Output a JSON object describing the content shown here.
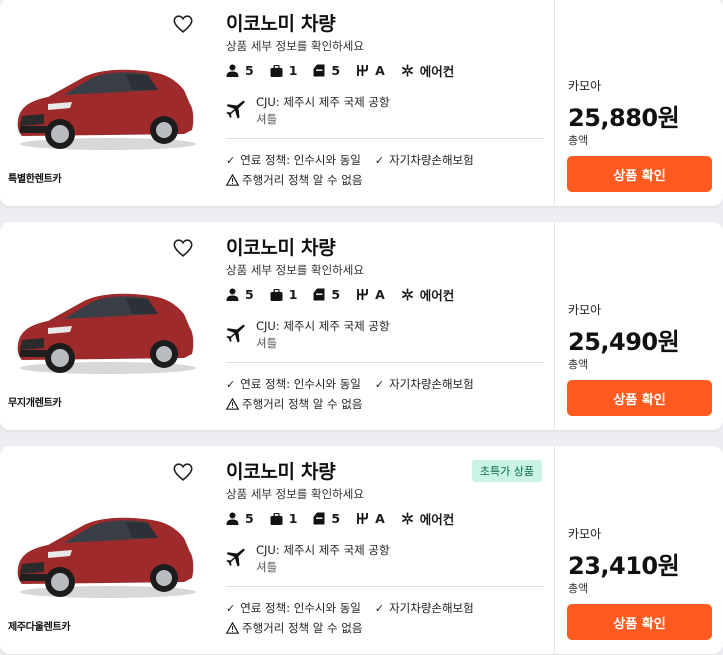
{
  "colors": {
    "accent": "#ff5a1f",
    "badge_bg": "#c9f4e4",
    "badge_fg": "#0b6b4c",
    "car_body": "#9e2a2b"
  },
  "cards": [
    {
      "title": "이코노미 차량",
      "subtitle": "상품 세부 정보를 확인하세요",
      "badge": "",
      "supplier": "특별한렌트카",
      "specs": {
        "seats": "5",
        "bags": "1",
        "doors": "5",
        "transmission": "A",
        "ac": "에어컨"
      },
      "pickup": {
        "location": "CJU: 제주시 제주 국제 공항",
        "type": "셔틀"
      },
      "policies": {
        "fuel": "연료 정책: 인수시와 동일",
        "insurance": "자기차량손해보험",
        "mileage": "주행거리 정책 알 수 없음"
      },
      "vendor": "카모아",
      "price": "25,880원",
      "price_label": "총액",
      "cta": "상품 확인"
    },
    {
      "title": "이코노미 차량",
      "subtitle": "상품 세부 정보를 확인하세요",
      "badge": "",
      "supplier": "무지개렌트카",
      "specs": {
        "seats": "5",
        "bags": "1",
        "doors": "5",
        "transmission": "A",
        "ac": "에어컨"
      },
      "pickup": {
        "location": "CJU: 제주시 제주 국제 공항",
        "type": "셔틀"
      },
      "policies": {
        "fuel": "연료 정책: 인수시와 동일",
        "insurance": "자기차량손해보험",
        "mileage": "주행거리 정책 알 수 없음"
      },
      "vendor": "카모아",
      "price": "25,490원",
      "price_label": "총액",
      "cta": "상품 확인"
    },
    {
      "title": "이코노미 차량",
      "subtitle": "상품 세부 정보를 확인하세요",
      "badge": "초특가 상품",
      "supplier": "제주다울렌트카",
      "specs": {
        "seats": "5",
        "bags": "1",
        "doors": "5",
        "transmission": "A",
        "ac": "에어컨"
      },
      "pickup": {
        "location": "CJU: 제주시 제주 국제 공항",
        "type": "셔틀"
      },
      "policies": {
        "fuel": "연료 정책: 인수시와 동일",
        "insurance": "자기차량손해보험",
        "mileage": "주행거리 정책 알 수 없음"
      },
      "vendor": "카모아",
      "price": "23,410원",
      "price_label": "총액",
      "cta": "상품 확인"
    }
  ]
}
